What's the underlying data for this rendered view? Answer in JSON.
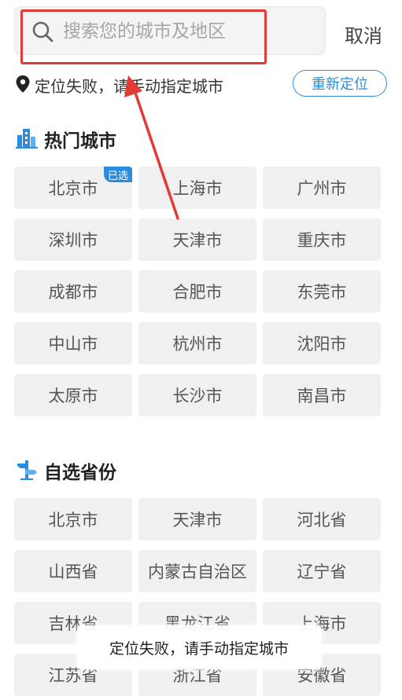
{
  "search": {
    "placeholder": "搜索您的城市及地区",
    "cancel_label": "取消"
  },
  "location": {
    "status_text": "定位失败，请手动指定城市",
    "relocate_label": "重新定位"
  },
  "hot_cities": {
    "title": "热门城市",
    "selected_badge": "已选",
    "items": [
      "北京市",
      "上海市",
      "广州市",
      "深圳市",
      "天津市",
      "重庆市",
      "成都市",
      "合肥市",
      "东莞市",
      "中山市",
      "杭州市",
      "沈阳市",
      "太原市",
      "长沙市",
      "南昌市"
    ]
  },
  "provinces": {
    "title": "自选省份",
    "items": [
      "北京市",
      "天津市",
      "河北省",
      "山西省",
      "内蒙古自治区",
      "辽宁省",
      "吉林省",
      "黑龙江省",
      "上海市",
      "江苏省",
      "浙江省",
      "安徽省"
    ]
  },
  "toast": {
    "text": "定位失败，请手动指定城市"
  },
  "colors": {
    "accent": "#2a8cdc",
    "annotation": "#e23a34",
    "cell_bg": "#f0f0f0"
  }
}
